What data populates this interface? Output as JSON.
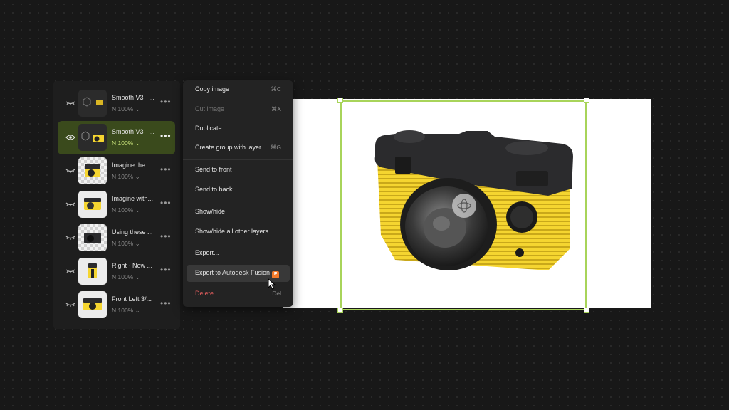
{
  "layers": [
    {
      "name": "Smooth V3 · ...",
      "opacity": "N 100%",
      "selected": false,
      "visible": false,
      "thumb": "dark"
    },
    {
      "name": "Smooth V3 · ...",
      "opacity": "N 100%",
      "selected": true,
      "visible": true,
      "thumb": "dark"
    },
    {
      "name": "Imagine the ...",
      "opacity": "N 100%",
      "selected": false,
      "visible": false,
      "thumb": "checker"
    },
    {
      "name": "Imagine with...",
      "opacity": "N 100%",
      "selected": false,
      "visible": false,
      "thumb": "light"
    },
    {
      "name": "Using these ...",
      "opacity": "N 100%",
      "selected": false,
      "visible": false,
      "thumb": "checker"
    },
    {
      "name": "Right - New ...",
      "opacity": "N 100%",
      "selected": false,
      "visible": false,
      "thumb": "light"
    },
    {
      "name": "Front Left 3/...",
      "opacity": "N 100%",
      "selected": false,
      "visible": false,
      "thumb": "light"
    }
  ],
  "context_menu": {
    "items": [
      {
        "label": "Copy image",
        "shortcut": "⌘C"
      },
      {
        "label": "Cut image",
        "shortcut": "⌘X"
      },
      {
        "label": "Duplicate",
        "shortcut": ""
      },
      {
        "label": "Create group with layer",
        "shortcut": "⌘G"
      },
      {
        "label": "Send to front",
        "shortcut": ""
      },
      {
        "label": "Send to back",
        "shortcut": ""
      },
      {
        "label": "Show/hide",
        "shortcut": ""
      },
      {
        "label": "Show/hide all other layers",
        "shortcut": ""
      },
      {
        "label": "Export...",
        "shortcut": ""
      },
      {
        "label": "Export to Autodesk Fusion",
        "shortcut": ""
      },
      {
        "label": "Delete",
        "shortcut": "Del"
      }
    ],
    "fusion_badge": "F"
  },
  "colors": {
    "accent": "#a8d45a",
    "selected_row": "#3a4a1c",
    "danger": "#e35d5d",
    "camera_body": "#f5d530",
    "camera_top": "#2b2b2d"
  },
  "icons": {
    "layer_hidden": "eye-closed-icon",
    "layer_visible": "eye-icon",
    "more": "more-horizontal-icon",
    "rotate": "rotate-3d-icon",
    "cursor": "pointer-cursor-icon"
  }
}
